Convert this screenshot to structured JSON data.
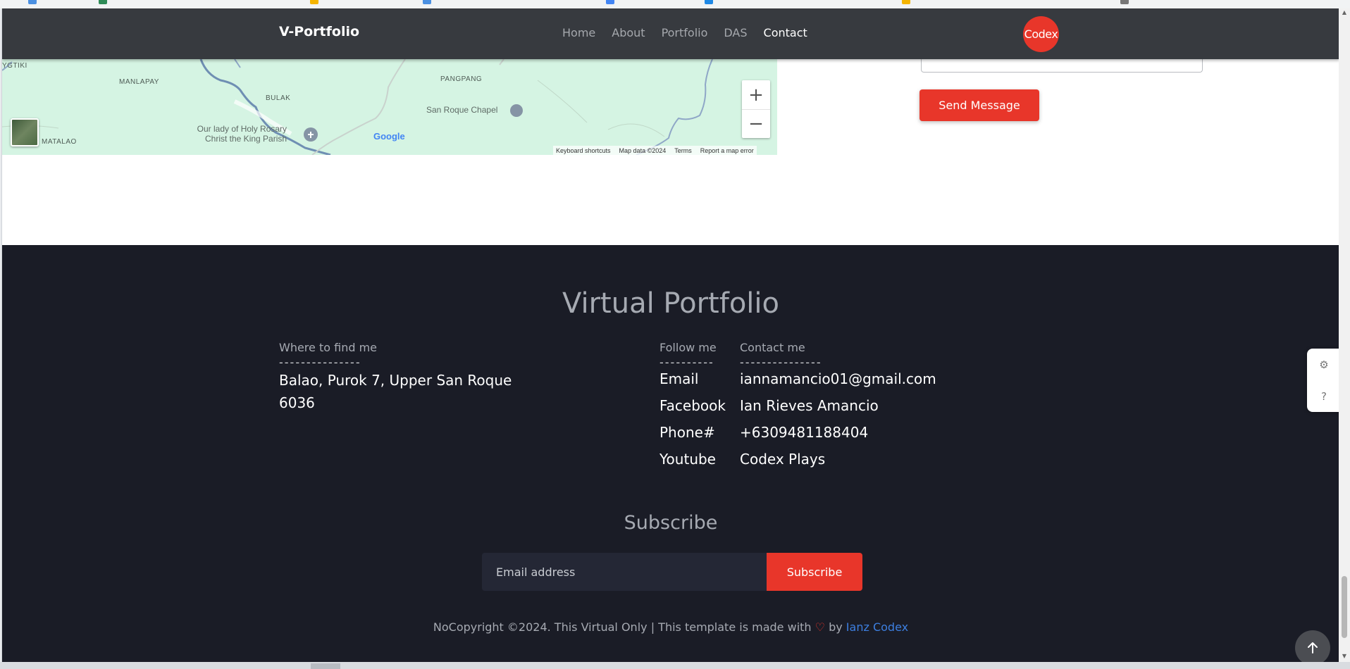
{
  "navbar": {
    "brand": "V-Portfolio",
    "links": [
      "Home",
      "About",
      "Portfolio",
      "DAS",
      "Contact"
    ],
    "active": "Contact",
    "badge": "Codex"
  },
  "map": {
    "labels": {
      "gtiki": "YGTIKI",
      "manlapay": "MANLAPAY",
      "bulak": "BULAK",
      "pangpang": "PANGPANG",
      "matalao": "MATALAO",
      "chapel": "San Roque Chapel",
      "parish_line1": "Our lady of Holy Rosary",
      "parish_line2": "Christ the King Parish"
    },
    "google": "Google",
    "zoom_in": "+",
    "zoom_out": "−",
    "attribution": {
      "shortcuts": "Keyboard shortcuts",
      "map_data": "Map data ©2024",
      "terms": "Terms",
      "report": "Report a map error"
    }
  },
  "contact_form": {
    "send_label": "Send Message"
  },
  "footer": {
    "title": "Virtual Portfolio",
    "where": {
      "label": "Where to find me",
      "dashes": "---------------",
      "line1": "Balao, Purok 7, Upper San Roque",
      "line2": "6036"
    },
    "follow": {
      "label": "Follow me",
      "dashes": "----------",
      "items": [
        "Email",
        "Facebook",
        "Phone#",
        "Youtube"
      ]
    },
    "contact": {
      "label": "Contact me",
      "dashes": "---------------",
      "items": [
        "iannamancio01@gmail.com",
        "Ian Rieves Amancio",
        "+6309481188404",
        "Codex Plays"
      ]
    },
    "subscribe": {
      "title": "Subscribe",
      "placeholder": "Email address",
      "button": "Subscribe"
    },
    "copyright": {
      "text": "NoCopyright ©2024. This Virtual Only | This template is made with",
      "heart": "♡",
      "by": "by",
      "author": "Ianz Codex"
    }
  },
  "widgets": {
    "settings_icon": "⚙",
    "help_icon": "?"
  }
}
